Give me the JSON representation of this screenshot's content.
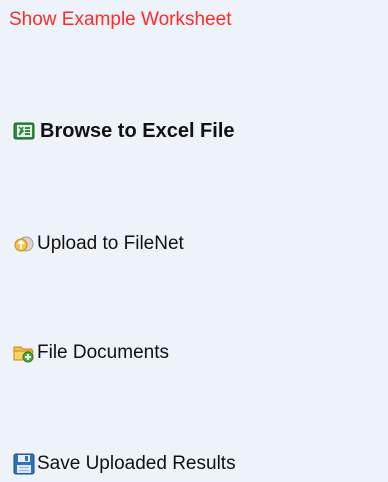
{
  "colors": {
    "background": "#eef2f9",
    "link": "#ff2a2a",
    "text": "#111111"
  },
  "example_link": {
    "label": "Show Example Worksheet"
  },
  "actions": [
    {
      "id": "browse",
      "label": "Browse to Excel File",
      "icon": "excel-icon",
      "bold": true
    },
    {
      "id": "upload",
      "label": "Upload to FileNet",
      "icon": "upload-icon",
      "bold": false
    },
    {
      "id": "filedocs",
      "label": "File Documents",
      "icon": "folder-add-icon",
      "bold": false
    },
    {
      "id": "save",
      "label": "Save Uploaded Results",
      "icon": "save-disk-icon",
      "bold": false
    }
  ]
}
